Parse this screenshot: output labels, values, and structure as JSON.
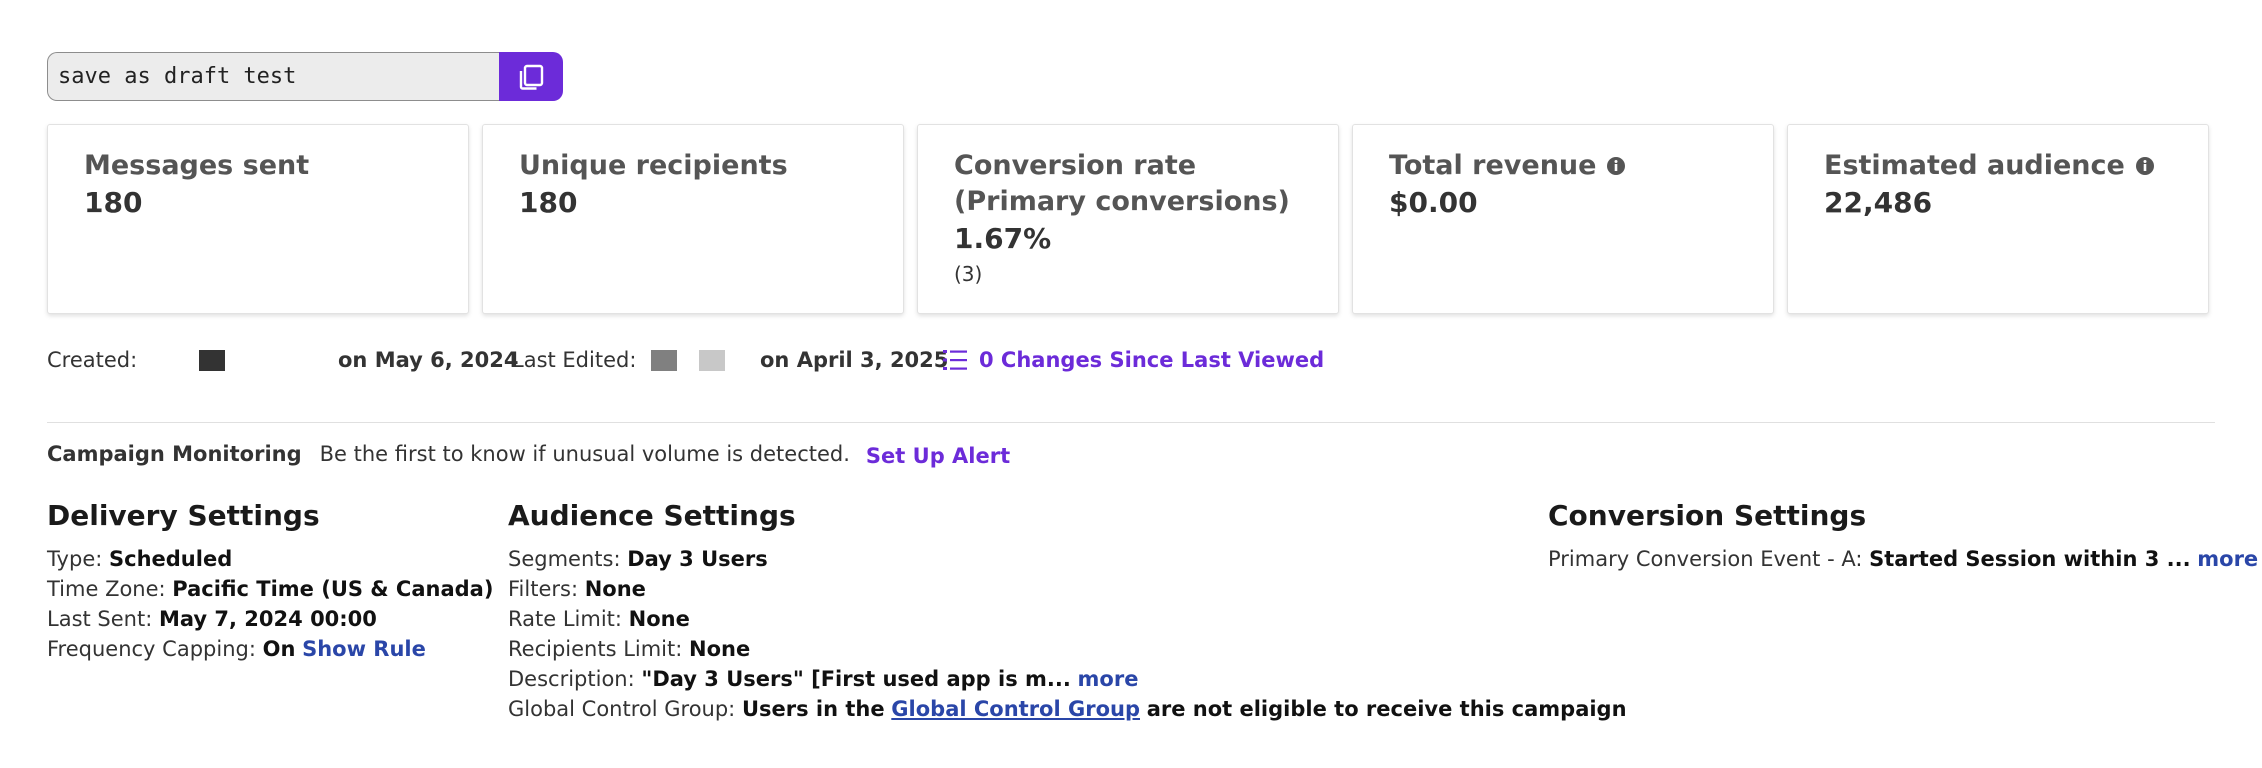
{
  "campaign": {
    "name_value": "save as draft test",
    "copy_icon": "copy-icon"
  },
  "stats": {
    "messages_sent": {
      "label": "Messages sent",
      "value": "180"
    },
    "unique_recipients": {
      "label": "Unique recipients",
      "value": "180"
    },
    "conversion_rate": {
      "label_line1": "Conversion rate",
      "label_line2": "(Primary conversions)",
      "value": "1.67%",
      "count": "(3)"
    },
    "total_revenue": {
      "label": "Total revenue",
      "value": "$0.00",
      "icon": "info-icon"
    },
    "estimated_audience": {
      "label": "Estimated audience",
      "value": "22,486",
      "icon": "info-icon"
    }
  },
  "meta": {
    "created_label": "Created:",
    "created_date": "on May 6, 2024",
    "edited_label": "Last Edited:",
    "edited_date": "on April 3, 2025",
    "changes_link": "0 Changes Since Last Viewed",
    "changes_icon": "list-icon"
  },
  "monitoring": {
    "title": "Campaign Monitoring",
    "text": "Be the first to know if unusual volume is detected.",
    "link": "Set Up Alert"
  },
  "delivery": {
    "title": "Delivery Settings",
    "type_label": "Type:",
    "type_value": "Scheduled",
    "tz_label": "Time Zone:",
    "tz_value": "Pacific Time (US & Canada)",
    "last_sent_label": "Last Sent:",
    "last_sent_value": "May 7, 2024 00:00",
    "freq_label": "Frequency Capping:",
    "freq_value": "On",
    "freq_link": "Show Rule"
  },
  "audience": {
    "title": "Audience Settings",
    "segments_label": "Segments:",
    "segments_value": "Day 3 Users",
    "filters_label": "Filters:",
    "filters_value": "None",
    "rate_label": "Rate Limit:",
    "rate_value": "None",
    "recipients_label": "Recipients Limit:",
    "recipients_value": "None",
    "description_label": "Description:",
    "description_value": "\"Day 3 Users\" [First used app is m...",
    "description_more": "more",
    "gcg_label": "Global Control Group:",
    "gcg_pre": "Users in the",
    "gcg_link": "Global Control Group",
    "gcg_post": "are not eligible to receive this campaign"
  },
  "conversion": {
    "title": "Conversion Settings",
    "event_label": "Primary Conversion Event - A:",
    "event_value": "Started Session within 3 ...",
    "event_more": "more"
  },
  "colors": {
    "accent": "#6c2bd9",
    "link": "#2a46a8",
    "swatch_dark": "#333333",
    "swatch_mid": "#808080",
    "swatch_light": "#c8c8c8"
  }
}
